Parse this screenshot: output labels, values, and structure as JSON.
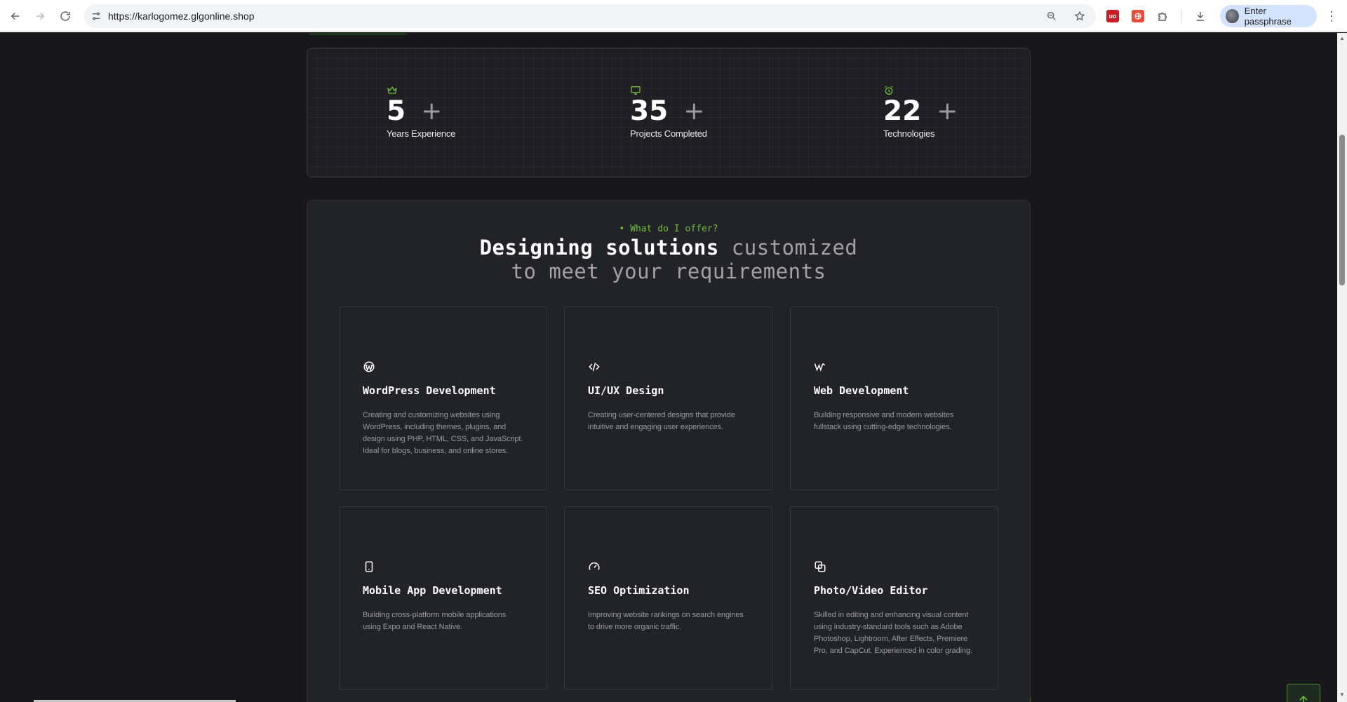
{
  "browser": {
    "url": "https://karlogomez.glgonline.shop",
    "profile_label": "Enter passphrase",
    "ext1_label": "uo"
  },
  "stats": [
    {
      "icon": "crown-icon",
      "value": "5",
      "suffix": "+",
      "label": "Years Experience"
    },
    {
      "icon": "monitor-icon",
      "value": "35",
      "suffix": "+",
      "label": "Projects Completed"
    },
    {
      "icon": "alarm-clock-icon",
      "value": "22",
      "suffix": "+",
      "label": "Technologies"
    }
  ],
  "services": {
    "eyebrow": "• What do I offer?",
    "heading_bright": "Designing solutions",
    "heading_dim_1": "customized",
    "heading_dim_2": "to meet your requirements",
    "cards": [
      {
        "icon": "wordpress-icon",
        "title": "WordPress Development",
        "desc": "Creating and customizing websites using WordPress, including themes, plugins, and design using PHP, HTML, CSS, and JavaScript. Ideal for blogs, business, and online stores."
      },
      {
        "icon": "code-icon",
        "title": "UI/UX Design",
        "desc": "Creating user-centered designs that provide intuitive and engaging user experiences."
      },
      {
        "icon": "webflow-icon",
        "title": "Web Development",
        "desc": "Building responsive and modern websites fullstack using cutting-edge technologies."
      },
      {
        "icon": "smartphone-icon",
        "title": "Mobile App Development",
        "desc": "Building cross-platform mobile applications using Expo and React Native."
      },
      {
        "icon": "gauge-icon",
        "title": "SEO Optimization",
        "desc": "Improving website rankings on search engines to drive more organic traffic."
      },
      {
        "icon": "photo-layers-icon",
        "title": "Photo/Video Editor",
        "desc": "Skilled in editing and enhancing visual content using industry-standard tools such as Adobe Photoshop, Lightroom, After Effects, Premiere Pro, and CapCut. Experienced in color grading."
      }
    ]
  },
  "colors": {
    "accent": "#6fbf3a",
    "background": "#17171c",
    "panel": "#222229"
  }
}
